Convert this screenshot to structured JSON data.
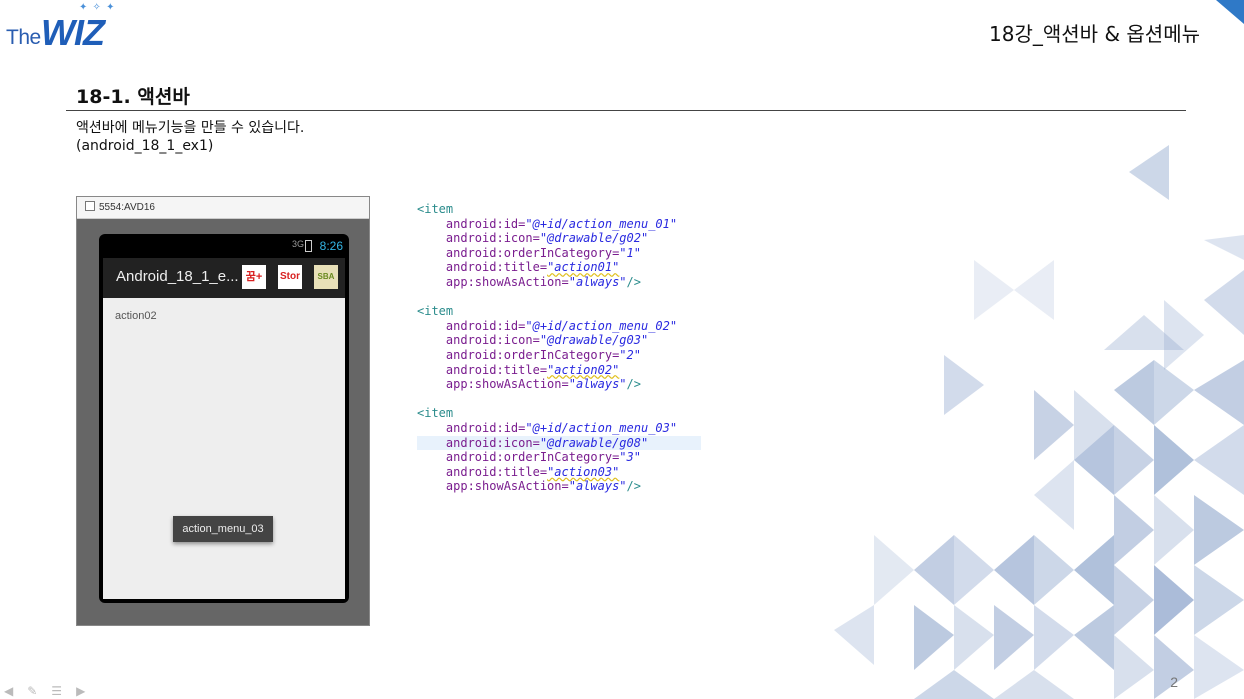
{
  "logo": {
    "the": "The",
    "wiz": "WIZ"
  },
  "header": {
    "title": "18강_액션바 & 옵션메뉴"
  },
  "section": {
    "title": "18-1. 액션바",
    "desc_line1": "액션바에 메뉴기능을 만들 수 있습니다.",
    "desc_line2": "(android_18_1_ex1)"
  },
  "emulator": {
    "window_title": "5554:AVD16",
    "status": {
      "signal": "3G",
      "time": "8:26"
    },
    "app_title": "Android_18_1_e...",
    "action_icons": [
      {
        "name": "g02-icon",
        "label": "꿈+"
      },
      {
        "name": "g03-icon",
        "label": "Stor"
      },
      {
        "name": "g08-icon",
        "label": "SBA"
      }
    ],
    "content_text": "action02",
    "toast": "action_menu_03"
  },
  "code": {
    "items": [
      {
        "id": "\"@+id/action_menu_01\"",
        "icon": "\"@drawable/g02\"",
        "order": "\"1\"",
        "title": "\"action01\"",
        "show": "\"always\""
      },
      {
        "id": "\"@+id/action_menu_02\"",
        "icon": "\"@drawable/g03\"",
        "order": "\"2\"",
        "title": "\"action02\"",
        "show": "\"always\""
      },
      {
        "id": "\"@+id/action_menu_03\"",
        "icon": "\"@drawable/g08\"",
        "order": "\"3\"",
        "title": "\"action03\"",
        "show": "\"always\""
      }
    ],
    "tag_open": "<item",
    "tag_close": "/>",
    "attr_id": "android:id=",
    "attr_icon": "android:icon=",
    "attr_order": "android:orderInCategory=",
    "attr_title": "android:title=",
    "attr_show": "app:showAsAction="
  },
  "page_number": "2",
  "colors": {
    "brand": "#1f5eb8",
    "accent_corner": "#2f79c7",
    "deco": "#8fa6cc"
  }
}
